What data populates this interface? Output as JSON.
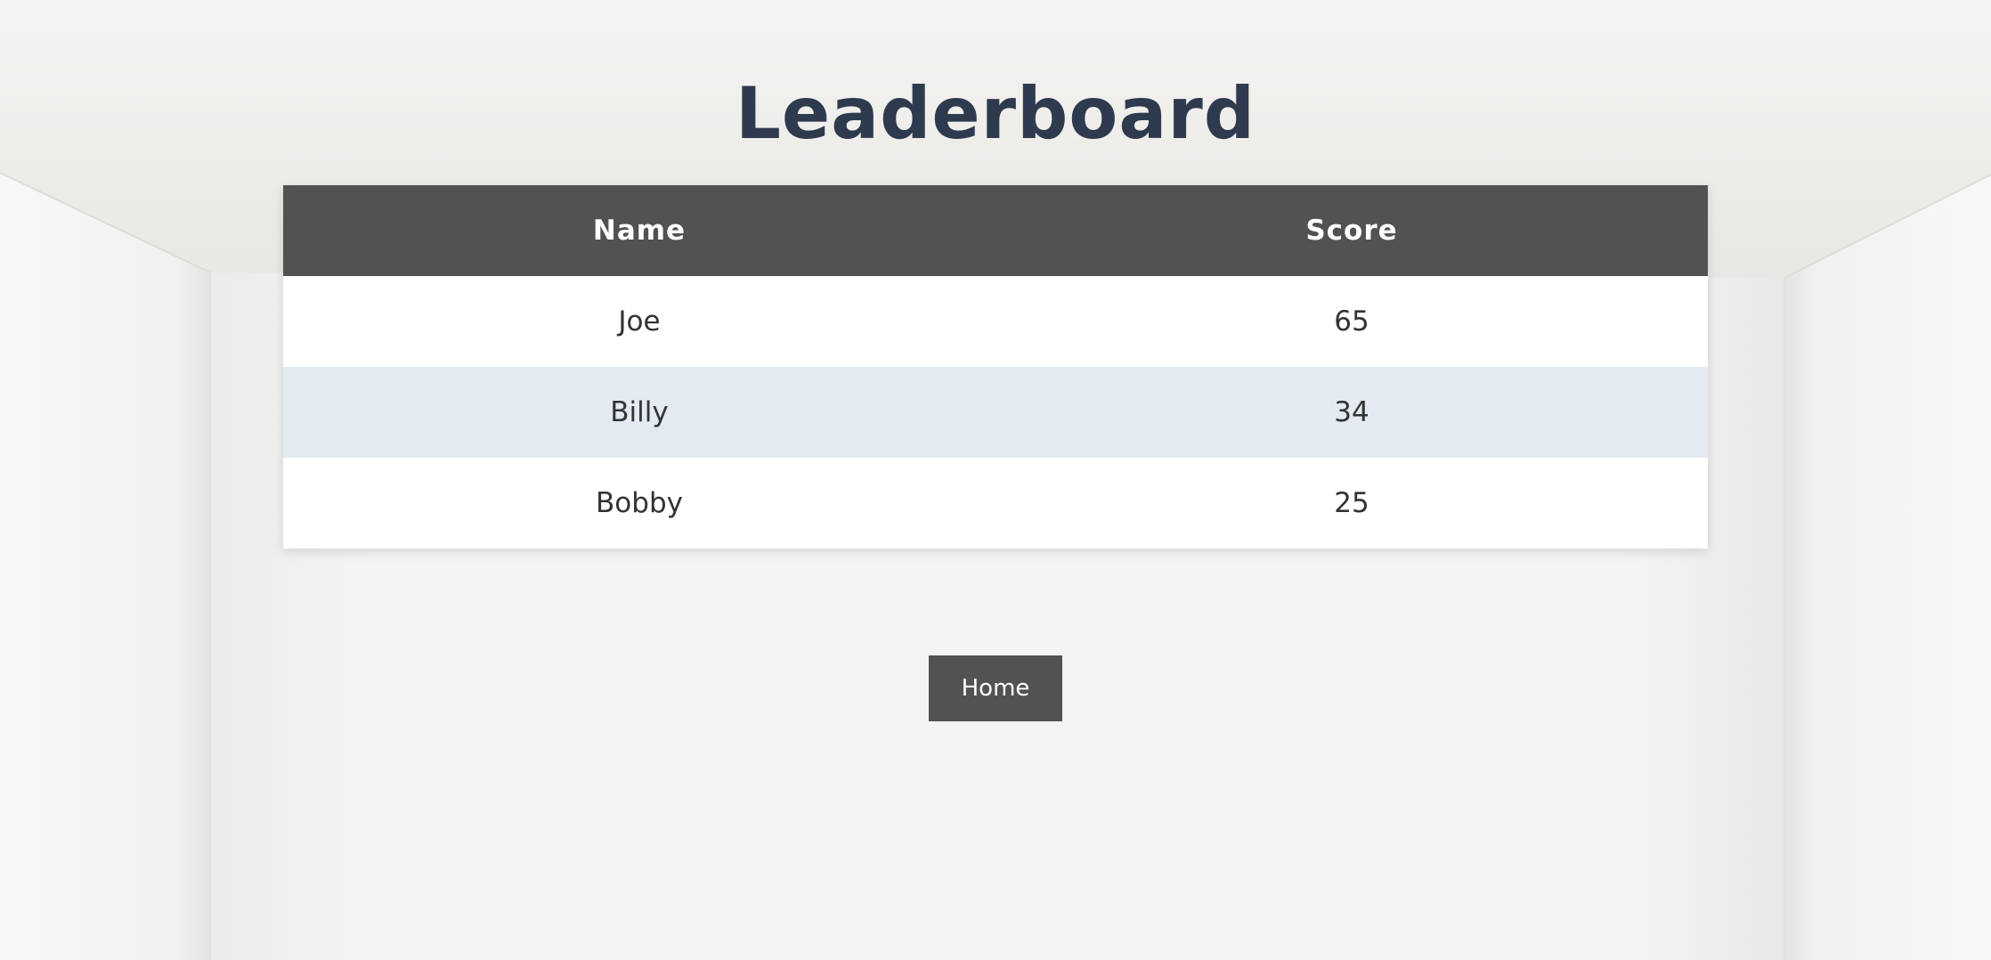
{
  "page": {
    "title": "Leaderboard"
  },
  "leaderboard": {
    "headers": [
      "Name",
      "Score"
    ],
    "rows": [
      {
        "name": "Joe",
        "score": "65"
      },
      {
        "name": "Billy",
        "score": "34"
      },
      {
        "name": "Bobby",
        "score": "25"
      }
    ]
  },
  "nav": {
    "home_label": "Home"
  },
  "colors": {
    "title": "#2e3a4e",
    "header_bg": "#525252",
    "alt_row": "#e3eaf2",
    "button_bg": "#525252"
  }
}
